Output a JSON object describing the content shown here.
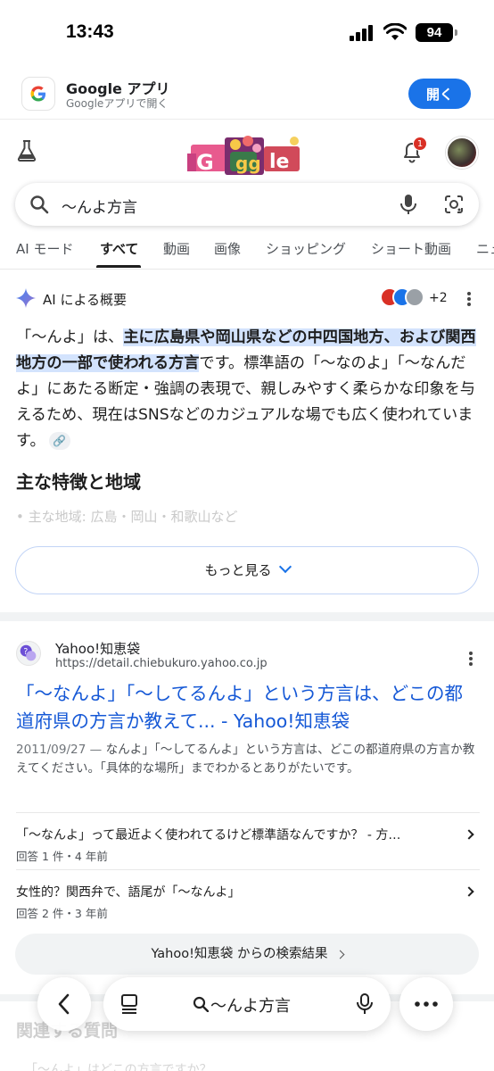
{
  "status_bar": {
    "time": "13:43",
    "battery": "94"
  },
  "app_banner": {
    "title": "Google アプリ",
    "subtitle": "Googleアプリで開く",
    "open_label": "開く"
  },
  "header": {
    "notification_count": "1"
  },
  "search": {
    "query": "〜んよ方言"
  },
  "tabs": [
    {
      "label": "AI モード"
    },
    {
      "label": "すべて"
    },
    {
      "label": "動画"
    },
    {
      "label": "画像"
    },
    {
      "label": "ショッピング"
    },
    {
      "label": "ショート動画"
    },
    {
      "label": "ニュ"
    }
  ],
  "ai_overview": {
    "title": "AI による概要",
    "sources_more": "+2",
    "body_pre": "「〜んよ」は、",
    "body_highlight": "主に広島県や岡山県などの中四国地方、および関西地方の一部で使われる方言",
    "body_post": "です。標準語の「〜なのよ」「〜なんだよ」にあたる断定・強調の表現で、親しみやすく柔らかな印象を与えるため、現在はSNSなどのカジュアルな場でも広く使われています。",
    "section_heading": "主な特徴と地域",
    "faded_bullet": "主な地域: 広島・岡山・和歌山など",
    "more_label": "もっと見る"
  },
  "result": {
    "site_name": "Yahoo!知恵袋",
    "url": "https://detail.chiebukuro.yahoo.co.jp",
    "title": "「〜なんよ」「〜してるんよ」という方言は、どこの都道府県の方言か教えて... - Yahoo!知恵袋",
    "date": "2011/09/27 —",
    "snippet": " なんよ」「〜してるんよ」という方言は、どこの都道府県の方言か教えてください。「具体的な場所」までわかるとありがたいです。",
    "sub_questions": [
      {
        "question": "「〜なんよ」って最近よく使われてるけど標準語なんですか？ - 方…",
        "meta": "回答 1 件・4 年前"
      },
      {
        "question": "女性的？関西弁で、語尾が「〜なんよ」",
        "meta": "回答 2 件・3 年前"
      }
    ],
    "more_from": "Yahoo!知恵袋 からの検索結果"
  },
  "related": {
    "heading": "関連する質問",
    "first_question": "「〜んよ」はどこの方言ですか？"
  },
  "toolbar": {
    "query": "〜んよ方言"
  },
  "colors": {
    "accent": "#1a73e8",
    "link": "#1558d6",
    "highlight": "#d3e3fd"
  }
}
